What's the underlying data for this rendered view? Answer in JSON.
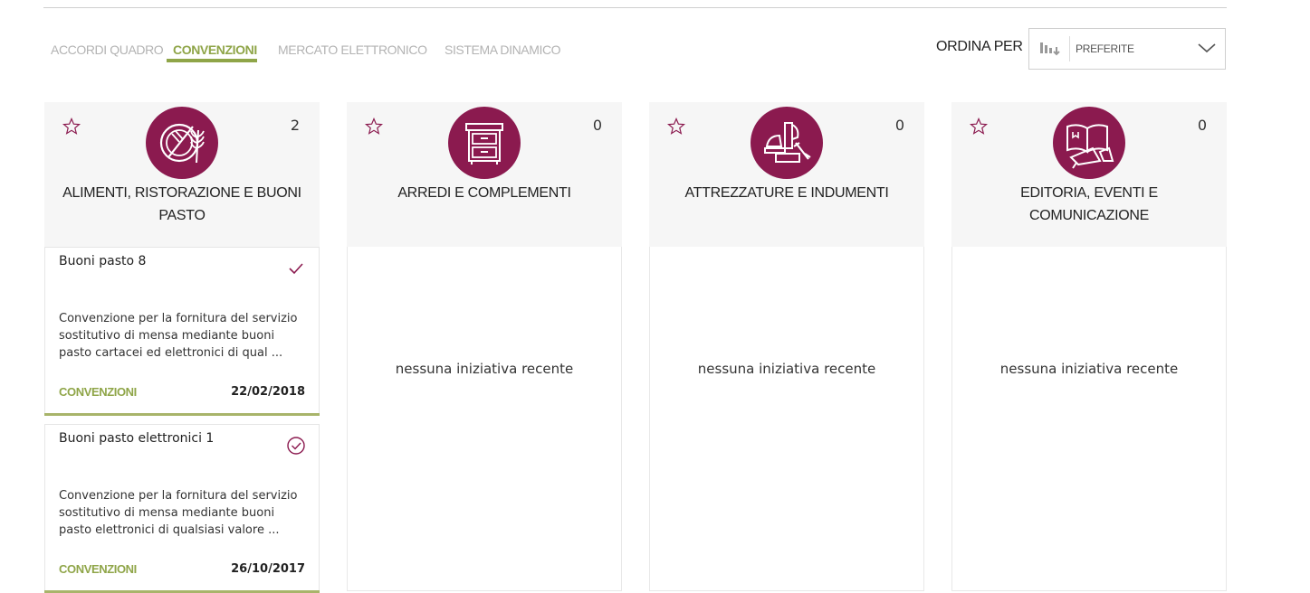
{
  "tabs": [
    {
      "label": "ACCORDI QUADRO",
      "active": false
    },
    {
      "label": "CONVENZIONI",
      "active": true
    },
    {
      "label": "MERCATO ELETTRONICO",
      "active": false
    },
    {
      "label": "SISTEMA DINAMICO",
      "active": false
    }
  ],
  "sort": {
    "label": "ORDINA PER",
    "value": "PREFERITE"
  },
  "colors": {
    "accent": "#8fa548",
    "brand": "#8b1a4f",
    "panel": "#f6f6f6"
  },
  "empty_text": "nessuna iniziativa recente",
  "categories": [
    {
      "title": "ALIMENTI, RISTORAZIONE E BUONI PASTO",
      "count": "2",
      "icon": "food-plate-icon",
      "cards": [
        {
          "title": "Buoni pasto 8",
          "description": "Convenzione per la fornitura del servizio sostitutivo di mensa mediante buoni pasto cartacei ed elettronici di qual ...",
          "type": "CONVENZIONI",
          "date": "22/02/2018",
          "status_icon": "check-icon"
        },
        {
          "title": "Buoni pasto elettronici 1",
          "description": "Convenzione per la fornitura del servizio sostitutivo di mensa mediante buoni pasto elettronici di qualsiasi valore ...",
          "type": "CONVENZIONI",
          "date": "26/10/2017",
          "status_icon": "check-circle-icon"
        }
      ]
    },
    {
      "title": "ARREDI E COMPLEMENTI",
      "count": "0",
      "icon": "cabinet-icon",
      "cards": []
    },
    {
      "title": "ATTREZZATURE E INDUMENTI",
      "count": "0",
      "icon": "tools-icon",
      "cards": []
    },
    {
      "title": "EDITORIA, EVENTI E COMUNICAZIONE",
      "count": "0",
      "icon": "book-megaphone-icon",
      "cards": []
    }
  ]
}
